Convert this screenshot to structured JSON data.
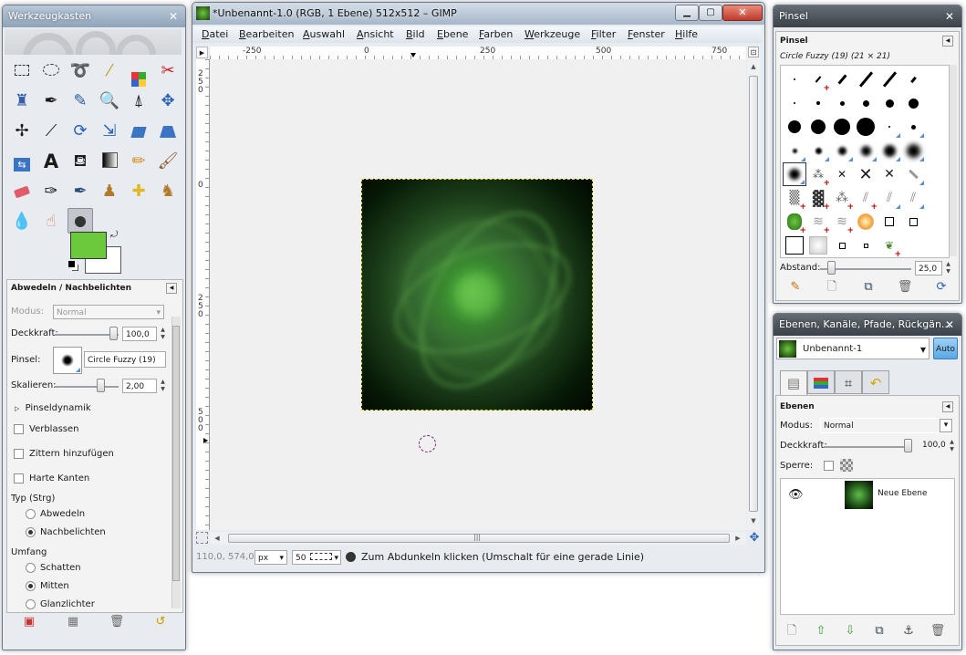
{
  "toolbox": {
    "title": "Werkzeugkasten",
    "tools": [
      "rect-select",
      "ellipse-select",
      "free-select",
      "fuzzy-select",
      "select-by-color",
      "scissors-select",
      "foreground-select",
      "paths",
      "color-picker",
      "zoom",
      "measure",
      "move",
      "align",
      "crop",
      "rotate",
      "scale",
      "shear",
      "perspective",
      "flip",
      "text",
      "bucket-fill",
      "blend",
      "pencil",
      "paintbrush",
      "eraser",
      "airbrush",
      "ink",
      "clone",
      "heal",
      "perspective-clone",
      "blur-sharpen",
      "smudge",
      "dodge-burn"
    ],
    "fg_color": "#6cc93c",
    "bg_color": "#ffffff",
    "options": {
      "title": "Abwedeln / Nachbelichten",
      "mode_label": "Modus:",
      "mode_value": "Normal",
      "opacity_label": "Deckkraft:",
      "opacity_value": "100,0",
      "brush_label": "Pinsel:",
      "brush_value": "Circle Fuzzy (19)",
      "scale_label": "Skalieren:",
      "scale_value": "2,00",
      "dynamics_label": "Pinseldynamik",
      "fade_label": "Verblassen",
      "jitter_label": "Zittern hinzufügen",
      "hard_edge_label": "Harte Kanten",
      "type_label": "Typ (Strg)",
      "type_dodge": "Abwedeln",
      "type_burn": "Nachbelichten",
      "range_label": "Umfang",
      "range_shadows": "Schatten",
      "range_midtones": "Mitten",
      "range_highlights": "Glanzlichter"
    }
  },
  "image_window": {
    "title": "*Unbenannt-1.0 (RGB, 1 Ebene) 512x512 – GIMP",
    "menu": [
      "Datei",
      "Bearbeiten",
      "Auswahl",
      "Ansicht",
      "Bild",
      "Ebene",
      "Farben",
      "Werkzeuge",
      "Filter",
      "Fenster",
      "Hilfe"
    ],
    "ruler_h": [
      "-250",
      "0",
      "250",
      "500",
      "750"
    ],
    "ruler_v": [
      "2\n5\n0",
      "0",
      "2\n5\n0",
      "5\n0\n0"
    ],
    "coords": "110,0, 574,0",
    "unit": "px",
    "zoom": "50",
    "status": "Zum Abdunkeln klicken (Umschalt für eine gerade Linie)"
  },
  "brushes": {
    "title": "Pinsel",
    "header": "Pinsel",
    "selected": "Circle Fuzzy (19)  (21 × 21)",
    "spacing_label": "Abstand:",
    "spacing_value": "25,0"
  },
  "layers": {
    "title": "Ebenen, Kanäle, Pfade, Rückgän...",
    "image_name": "Unbenannt-1",
    "auto_label": "Auto",
    "header": "Ebenen",
    "mode_label": "Modus:",
    "mode_value": "Normal",
    "opacity_label": "Deckkraft:",
    "opacity_value": "100,0",
    "lock_label": "Sperre:",
    "layer_name": "Neue Ebene"
  }
}
